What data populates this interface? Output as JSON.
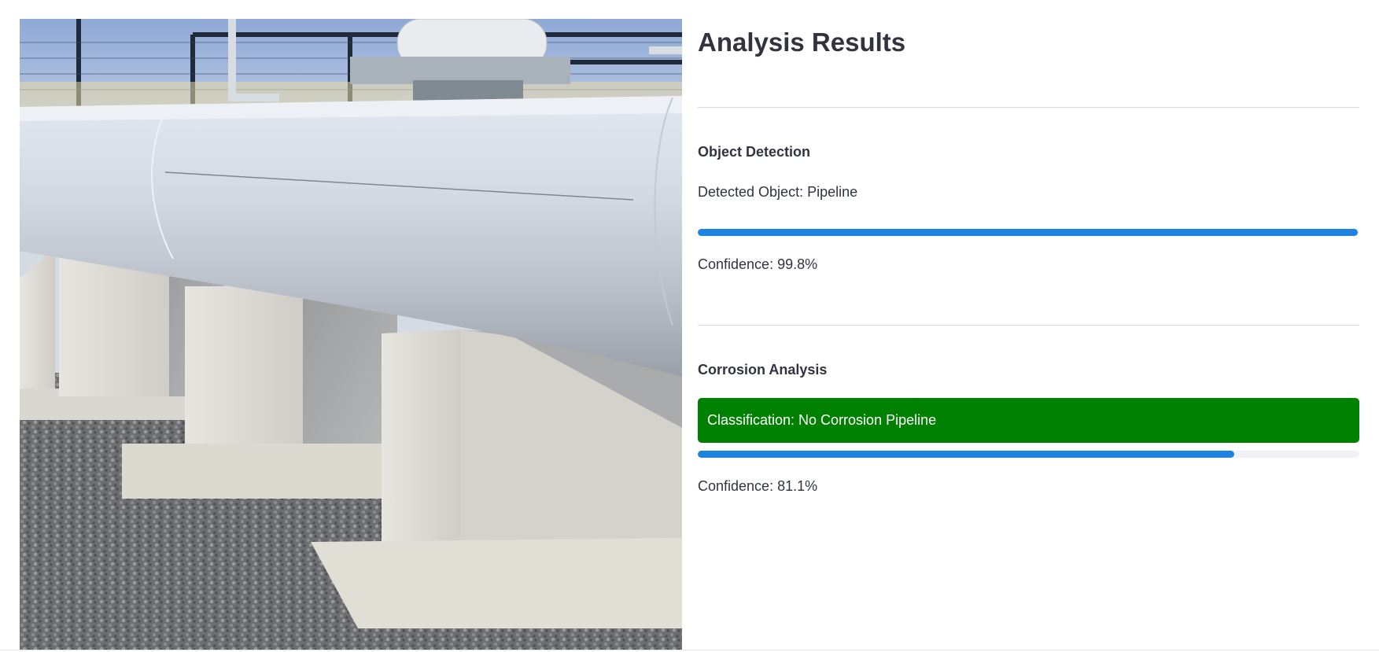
{
  "image": {
    "alt": "pipeline-photo"
  },
  "results": {
    "title": "Analysis Results",
    "object_detection": {
      "heading": "Object Detection",
      "detected_text": "Detected Object: Pipeline",
      "confidence_fraction": 0.998,
      "confidence_text": "Confidence: 99.8%"
    },
    "corrosion_analysis": {
      "heading": "Corrosion Analysis",
      "classification_text": "Classification: No Corrosion Pipeline",
      "confidence_fraction": 0.811,
      "confidence_text": "Confidence: 81.1%"
    }
  },
  "colors": {
    "progress_fill": "#1c83e1",
    "progress_track": "#f0f2f6",
    "classification_bg": "#008000",
    "text": "#31333f"
  }
}
